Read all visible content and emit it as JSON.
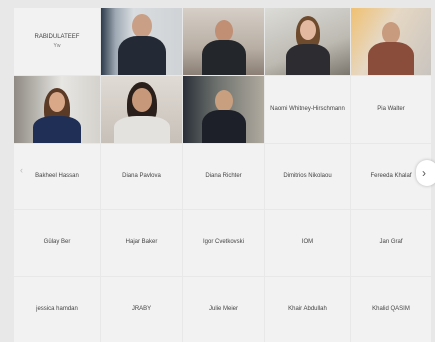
{
  "tiles": [
    {
      "name": "RABIDULATEEF",
      "sub": "Yw",
      "video": false
    },
    {
      "name": "",
      "video": true,
      "style": "v1"
    },
    {
      "name": "",
      "video": true,
      "style": "v2"
    },
    {
      "name": "",
      "video": true,
      "style": "v3"
    },
    {
      "name": "",
      "video": true,
      "style": "v4"
    },
    {
      "name": "",
      "video": true,
      "style": "v5"
    },
    {
      "name": "",
      "video": true,
      "style": "v6"
    },
    {
      "name": "",
      "video": true,
      "style": "v7"
    },
    {
      "name": "Naomi Whitney-Hirschmann",
      "video": false
    },
    {
      "name": "Pia Walter",
      "video": false
    },
    {
      "name": "Bakheel Hassan",
      "video": false
    },
    {
      "name": "Diana Pavlova",
      "video": false
    },
    {
      "name": "Diana Richter",
      "video": false
    },
    {
      "name": "Dimitrios Nikolaou",
      "video": false
    },
    {
      "name": "Fereeda Khalaf",
      "video": false
    },
    {
      "name": "Gülay Ber",
      "video": false
    },
    {
      "name": "Hajar Baker",
      "video": false
    },
    {
      "name": "Igor Cvetkovski",
      "video": false
    },
    {
      "name": "IOM",
      "video": false
    },
    {
      "name": "Jan Graf",
      "video": false
    },
    {
      "name": "jessica hamdan",
      "video": false
    },
    {
      "name": "JRABY",
      "video": false
    },
    {
      "name": "Julie Meier",
      "video": false
    },
    {
      "name": "Khair Abdullah",
      "video": false
    },
    {
      "name": "Khalid QASIM",
      "video": false
    }
  ],
  "navigation": {
    "next_icon": "chevron-right-icon",
    "next_glyph": "›",
    "prev_icon": "chevron-left-icon",
    "prev_glyph": "‹"
  }
}
